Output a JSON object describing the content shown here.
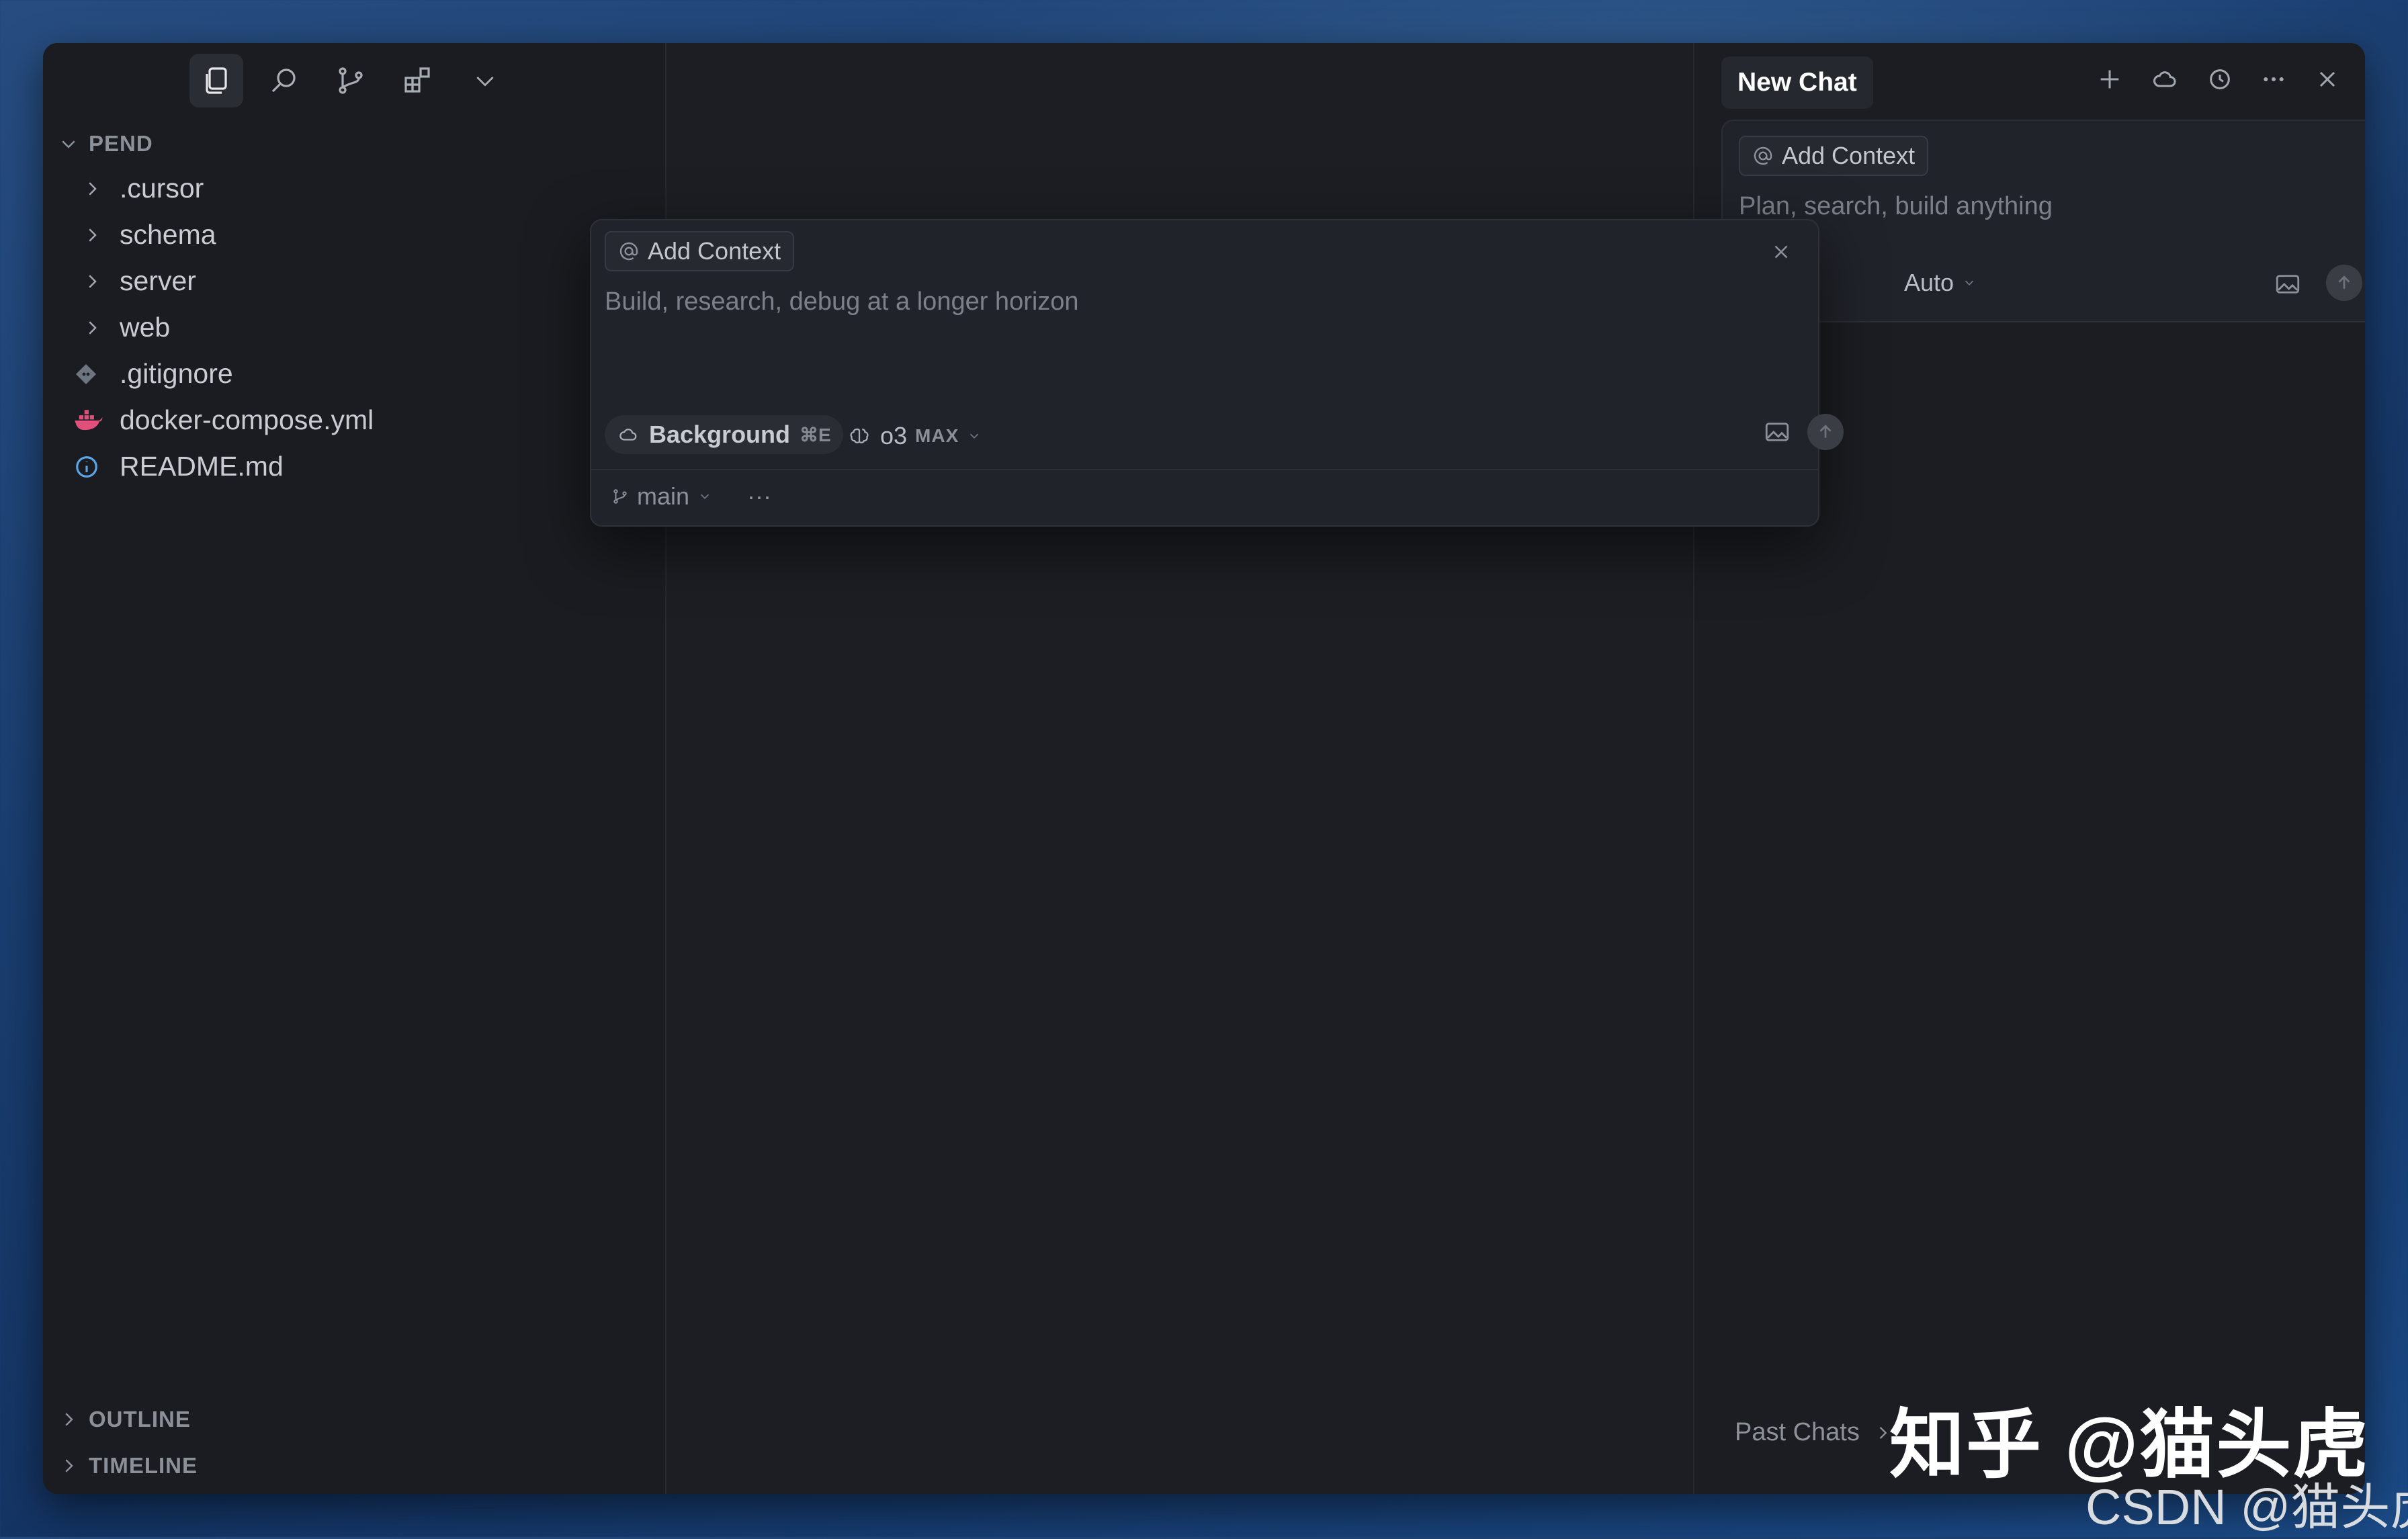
{
  "sidebar": {
    "activity_icons": [
      "files-icon",
      "search-icon",
      "source-control-icon",
      "extensions-icon",
      "chevron-down-icon"
    ],
    "section_title": "PEND",
    "items": [
      {
        "label": ".cursor",
        "kind": "folder",
        "icon": "chevron-right-icon"
      },
      {
        "label": "schema",
        "kind": "folder",
        "icon": "chevron-right-icon"
      },
      {
        "label": "server",
        "kind": "folder",
        "icon": "chevron-right-icon"
      },
      {
        "label": "web",
        "kind": "folder",
        "icon": "chevron-right-icon"
      },
      {
        "label": ".gitignore",
        "kind": "file",
        "icon": "git-icon"
      },
      {
        "label": "docker-compose.yml",
        "kind": "file",
        "icon": "docker-icon"
      },
      {
        "label": "README.md",
        "kind": "file",
        "icon": "info-icon"
      }
    ],
    "bottom_sections": [
      "OUTLINE",
      "TIMELINE"
    ]
  },
  "background_agent": {
    "add_context": "Add Context",
    "placeholder": "Build, research, debug at a longer horizon",
    "mode_label": "Background",
    "mode_shortcut": "⌘E",
    "model": "o3",
    "model_badge": "MAX",
    "branch": "main",
    "more": "···"
  },
  "chat": {
    "tab_title": "New Chat",
    "add_context": "Add Context",
    "placeholder": "Plan, search, build anything",
    "model": "Auto",
    "past_chats": "Past Chats"
  },
  "watermark": {
    "zhihu": "知乎 @猫头虎",
    "csdn": "CSDN @猫头虎"
  },
  "colors": {
    "window_bg": "#1b1d22",
    "text": "#c9ccd2",
    "muted": "#7c8088",
    "docker": "#e0507a",
    "info": "#5aa6e6"
  }
}
